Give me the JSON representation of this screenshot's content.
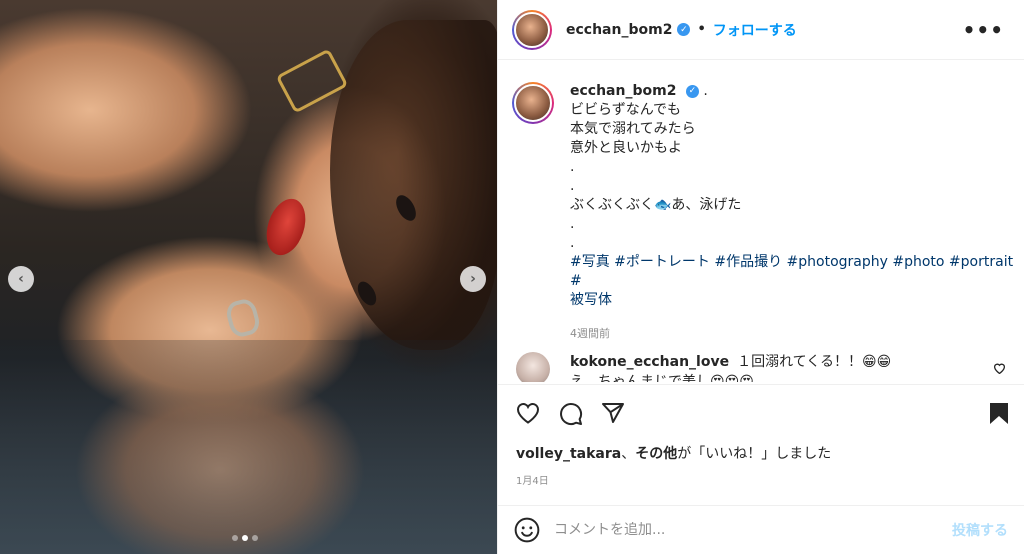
{
  "post": {
    "username": "ecchan_bom2",
    "verified_mark": "✓",
    "separator": "•",
    "follow_label": "フォローする",
    "more_label": "•••"
  },
  "caption": {
    "username": "ecchan_bom2",
    "dot": ".",
    "lines": [
      "ビビらずなんでも",
      "本気で溺れてみたら",
      "意外と良いかもよ",
      ".",
      ".",
      "ぶくぶくぶく🐟あ、泳げた",
      ".",
      "."
    ],
    "hashtags_line1": "#写真 #ポートレート #作品撮り #photography #photo #portrait #",
    "hashtags_line2": "被写体",
    "time_ago": "4週間前"
  },
  "comment": {
    "username": "kokone_ecchan_love",
    "text": "１回溺れてくる！！😁😁",
    "text2": "え、ちゃんまじで美し😍😍😍"
  },
  "carousel": {
    "prev": "‹",
    "next": "›",
    "dots": 3,
    "active_dot": 1
  },
  "likes": {
    "user": "volley_takara",
    "middle": "、",
    "others": "その他",
    "suffix": "が「いいね！」しました"
  },
  "date": "1月4日",
  "add_comment": {
    "placeholder": "コメントを追加...",
    "post_label": "投稿する"
  },
  "colors": {
    "link": "#0095f6",
    "hashtag": "#00376b",
    "muted": "#8e8e8e",
    "post_disabled": "#b2dffc"
  }
}
